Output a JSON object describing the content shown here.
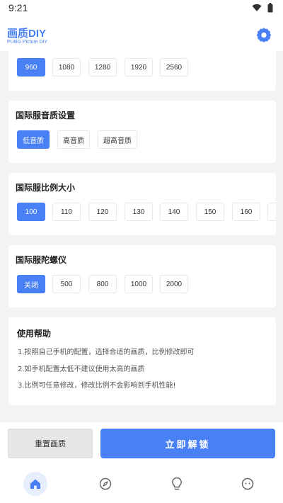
{
  "status": {
    "time": "9:21"
  },
  "header": {
    "title": "画质DIY",
    "subtitle": "PUBG Picture DIY"
  },
  "resolution": {
    "options": [
      "960",
      "1080",
      "1280",
      "1920",
      "2560"
    ],
    "selected": "960"
  },
  "audio": {
    "title": "国际服音质设置",
    "options": [
      "低音质",
      "高音质",
      "超高音质"
    ],
    "selected": "低音质"
  },
  "ratio": {
    "title": "国际服比例大小",
    "options": [
      "100",
      "110",
      "120",
      "130",
      "140",
      "150",
      "160"
    ],
    "selected": "100"
  },
  "gyro": {
    "title": "国际服陀螺仪",
    "options": [
      "关闭",
      "500",
      "800",
      "1000",
      "2000"
    ],
    "selected": "关闭"
  },
  "help": {
    "title": "使用帮助",
    "lines": [
      "1.按照自己手机的配置，选择合适的画质，比例修改即可",
      "2.如手机配置太低不建议使用太高的画质",
      "3.比例可任意修改，修改比例不会影响到手机性能!"
    ]
  },
  "actions": {
    "reset_label": "重置画质",
    "unlock_label": "立即解锁"
  },
  "colors": {
    "accent": "#4a80f5"
  },
  "nav": {
    "icons": [
      "home-icon",
      "compass-icon",
      "bulb-icon",
      "face-icon"
    ],
    "active": "home-icon"
  }
}
